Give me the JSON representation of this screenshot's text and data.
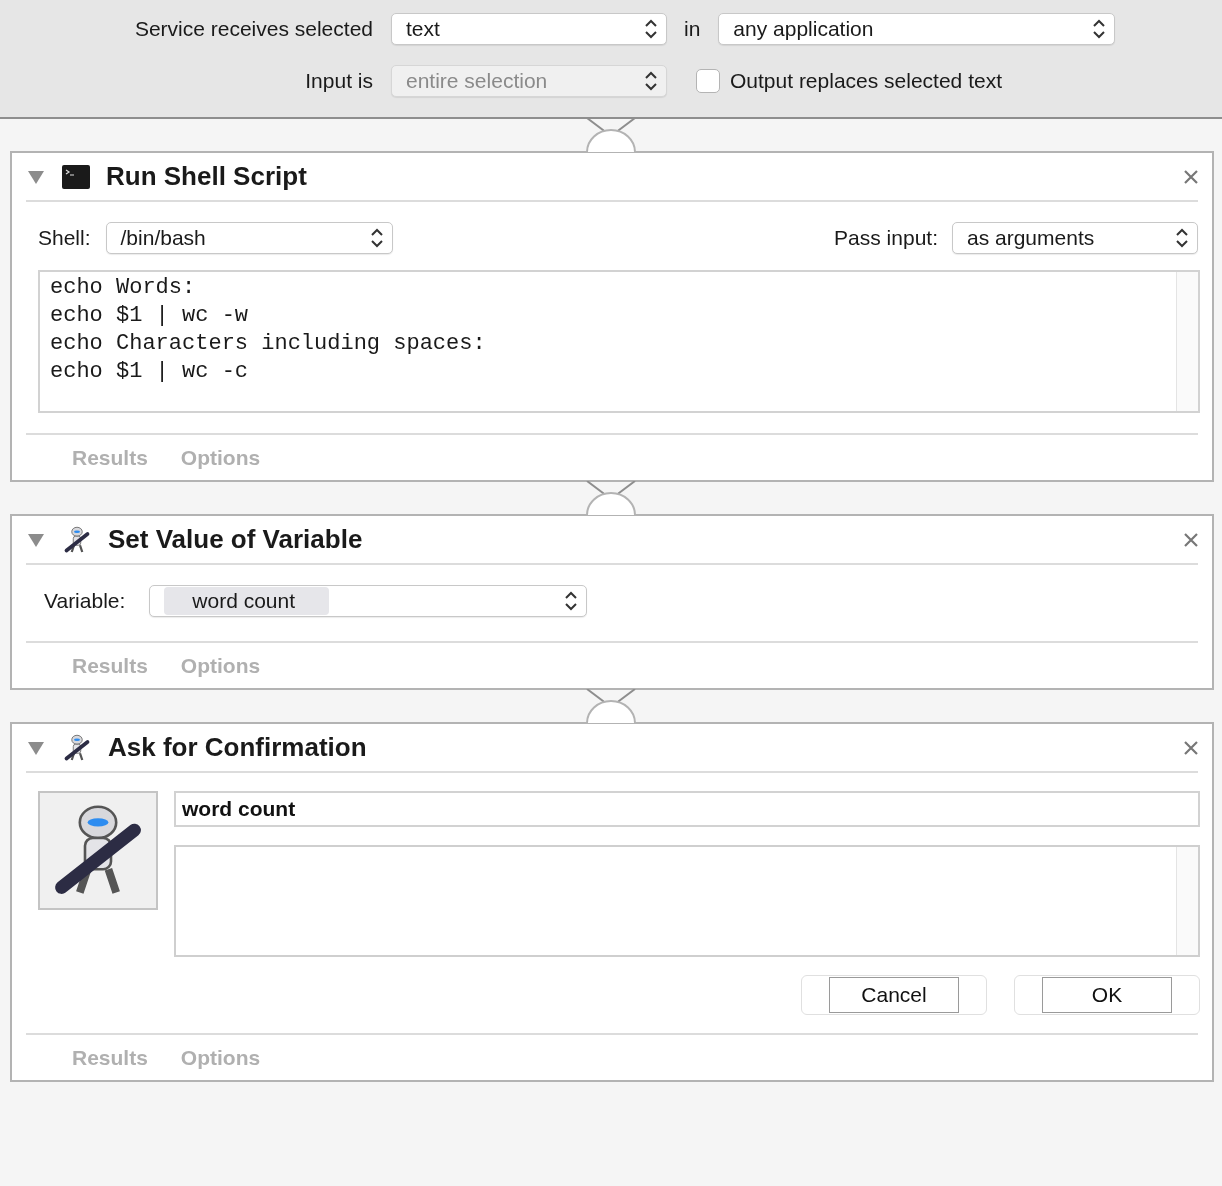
{
  "header": {
    "receives_label": "Service receives selected",
    "receives_value": "text",
    "in_label": "in",
    "application_value": "any application",
    "input_label": "Input is",
    "input_value": "entire selection",
    "input_disabled": true,
    "output_checkbox": {
      "label": "Output replaces selected text",
      "checked": false
    }
  },
  "actions": [
    {
      "kind": "shell",
      "title": "Run Shell Script",
      "expanded": true,
      "shell_label": "Shell:",
      "shell_value": "/bin/bash",
      "pass_label": "Pass input:",
      "pass_value": "as arguments",
      "script": [
        "echo Words:",
        "echo $1 | wc -w",
        "echo Characters including spaces:",
        "echo $1 | wc -c"
      ],
      "footer": [
        "Results",
        "Options"
      ]
    },
    {
      "kind": "variable",
      "title": "Set Value of Variable",
      "expanded": true,
      "variable_label": "Variable:",
      "variable_value": "word count",
      "footer": [
        "Results",
        "Options"
      ]
    },
    {
      "kind": "confirm",
      "title": "Ask for Confirmation",
      "expanded": true,
      "message_title": "word count",
      "buttons": [
        "Cancel",
        "OK"
      ],
      "footer": [
        "Results",
        "Options"
      ]
    }
  ]
}
